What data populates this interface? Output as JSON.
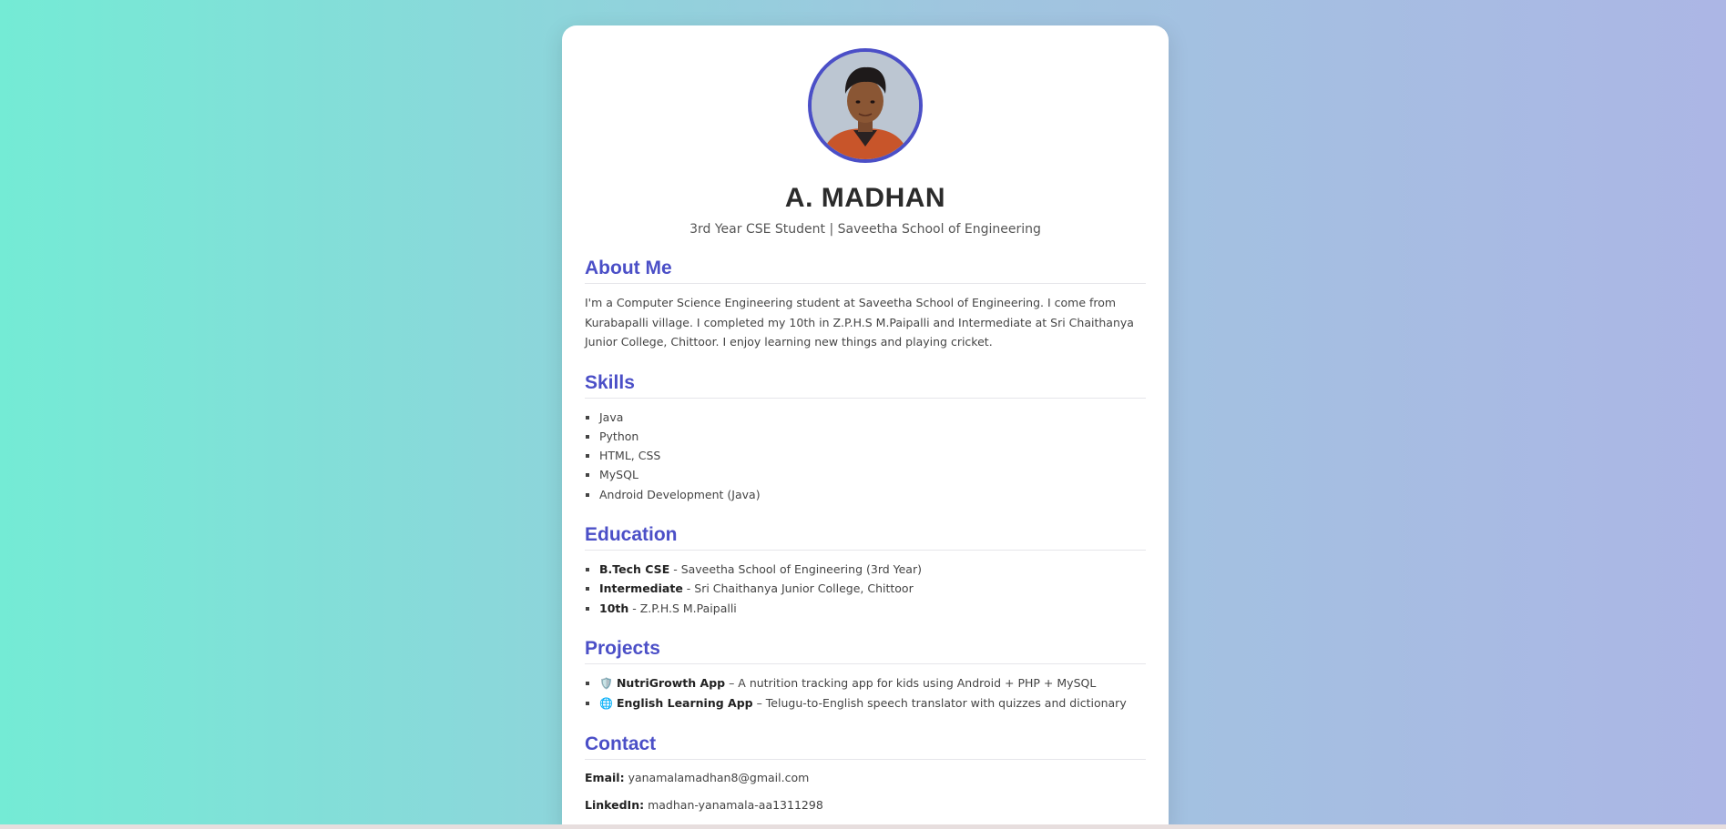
{
  "profile": {
    "name": "A. MADHAN",
    "subtitle": "3rd Year CSE Student | Saveetha School of Engineering",
    "avatar_icon": "profile-photo"
  },
  "about": {
    "heading": "About Me",
    "text": "I'm a Computer Science Engineering student at Saveetha School of Engineering. I come from Kurabapalli village. I completed my 10th in Z.P.H.S M.Paipalli and Intermediate at Sri Chaithanya Junior College, Chittoor. I enjoy learning new things and playing cricket."
  },
  "skills": {
    "heading": "Skills",
    "items": [
      "Java",
      "Python",
      "HTML, CSS",
      "MySQL",
      "Android Development (Java)"
    ]
  },
  "education": {
    "heading": "Education",
    "items": [
      {
        "degree": "B.Tech CSE",
        "detail": " - Saveetha School of Engineering (3rd Year)"
      },
      {
        "degree": "Intermediate",
        "detail": " - Sri Chaithanya Junior College, Chittoor"
      },
      {
        "degree": "10th",
        "detail": " - Z.P.H.S M.Paipalli"
      }
    ]
  },
  "projects": {
    "heading": "Projects",
    "items": [
      {
        "icon": "🛡️",
        "icon_name": "shield-icon",
        "title": "NutriGrowth App",
        "detail": " – A nutrition tracking app for kids using Android + PHP + MySQL"
      },
      {
        "icon": "🌐",
        "icon_name": "globe-icon",
        "title": "English Learning App",
        "detail": " – Telugu-to-English speech translator with quizzes and dictionary"
      }
    ]
  },
  "contact": {
    "heading": "Contact",
    "email_label": "Email:",
    "email": "yanamalamadhan8@gmail.com",
    "linkedin_label": "LinkedIn:",
    "linkedin": "madhan-yanamala-aa1311298"
  },
  "colors": {
    "accent": "#4b4fc7",
    "bg_left": "#74ebd5",
    "bg_right": "#acb6e5"
  }
}
